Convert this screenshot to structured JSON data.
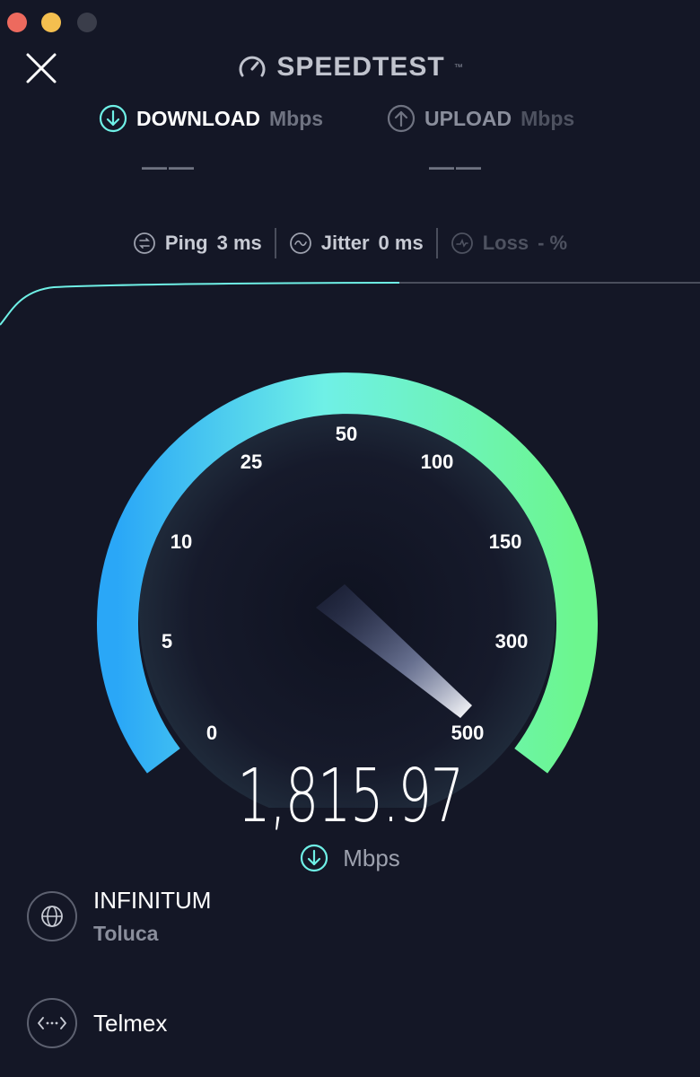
{
  "window": {
    "title": "SPEEDTEST"
  },
  "download": {
    "label": "DOWNLOAD",
    "unit": "Mbps",
    "value": "——"
  },
  "upload": {
    "label": "UPLOAD",
    "unit": "Mbps",
    "value": "——"
  },
  "metrics": {
    "ping_label": "Ping",
    "ping_value": "3 ms",
    "jitter_label": "Jitter",
    "jitter_value": "0 ms",
    "loss_label": "Loss",
    "loss_value": "- %"
  },
  "gauge": {
    "tick_labels": [
      "0",
      "5",
      "10",
      "25",
      "50",
      "100",
      "150",
      "300",
      "500"
    ],
    "speed": "1,815.97",
    "unit": "Mbps",
    "needle_value": 500
  },
  "server": {
    "provider": "INFINITUM",
    "location": "Toluca"
  },
  "isp": {
    "name": "Telmex"
  },
  "colors": {
    "background": "#141726",
    "accent": "#6ff0e6",
    "gauge_start": "#2aa7f7",
    "gauge_end": "#6cf68e"
  },
  "icons": {
    "close": "close-icon",
    "download": "download-arrow-icon",
    "upload": "upload-arrow-icon",
    "ping": "ping-icon",
    "jitter": "jitter-icon",
    "loss": "loss-icon",
    "globe": "globe-icon",
    "connection": "connection-icon"
  }
}
